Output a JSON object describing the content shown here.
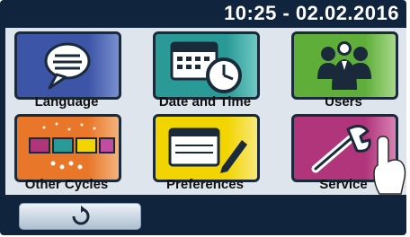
{
  "header": {
    "datetime": "10:25 - 02.02.2016"
  },
  "tiles": [
    {
      "label": "Language",
      "icon": "speech-bubble-icon",
      "color": "#3c55a6"
    },
    {
      "label": "Date and Time",
      "icon": "calendar-clock-icon",
      "color": "#2a9a96"
    },
    {
      "label": "Users",
      "icon": "users-group-icon",
      "color": "#5fae3a"
    },
    {
      "label": "Other Cycles",
      "icon": "wash-cycles-icon",
      "color": "#e8772a"
    },
    {
      "label": "Preferences",
      "icon": "pen-printer-icon",
      "color": "#f2d400"
    },
    {
      "label": "Service",
      "icon": "wrench-icon",
      "color": "#b0357a"
    }
  ],
  "footer": {
    "back_icon": "rotate-back-icon"
  }
}
